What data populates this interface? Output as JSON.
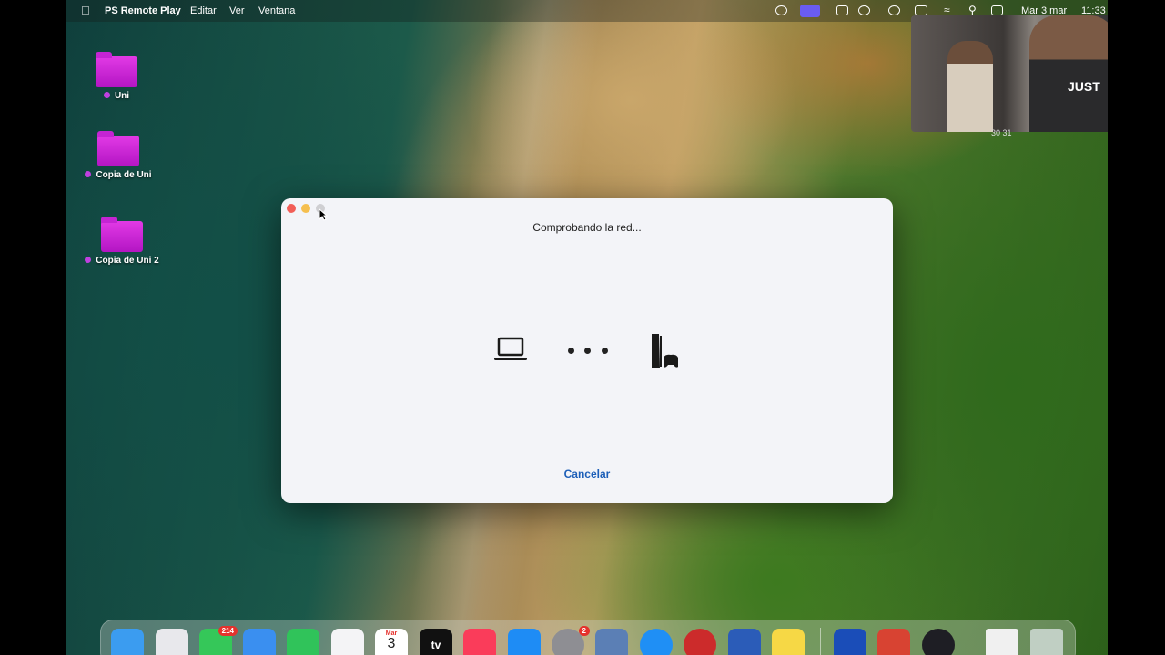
{
  "menubar": {
    "app_name": "PS Remote Play",
    "menus": [
      "Editar",
      "Ver",
      "Ventana"
    ],
    "date": "Mar 3 mar",
    "time": "11:33"
  },
  "desktop": {
    "items": [
      {
        "label": "Uni"
      },
      {
        "label": "Copia de Uni"
      },
      {
        "label": "Copia de Uni 2"
      }
    ]
  },
  "dialog": {
    "status": "Comprobando la red...",
    "cancel_label": "Cancelar",
    "icons": [
      "laptop-icon",
      "ps5-console-icon"
    ]
  },
  "camera_overlay": {
    "shirt_text": "JUST",
    "caption": "30  31"
  },
  "dock": {
    "calendar_month": "Mar",
    "calendar_day": "3",
    "tv_label": "tv",
    "badges": {
      "messages": "214",
      "settings": "2"
    },
    "apps": [
      "Finder",
      "Launchpad",
      "Messages",
      "Mail",
      "FaceTime",
      "Reminders",
      "Calendar",
      "TV",
      "Music",
      "App Store",
      "System Settings",
      "Preview",
      "Safari",
      "Vivaldi",
      "Word",
      "Notes",
      "PS Remote Play",
      "Rocket",
      "OBS",
      "Document",
      "Trash"
    ],
    "colors": {
      "finder": "#3b9cf0",
      "messages": "#35c759",
      "mail": "#3a8ff0",
      "facetime": "#30c35a",
      "music": "#fa3c5a",
      "appstore": "#1e8cf5",
      "settings": "#8e8e93",
      "safari": "#1f8ff5",
      "vivaldi": "#cc2b2b",
      "word": "#2b5cb8",
      "notes": "#f6d845",
      "psremote": "#1a4db8",
      "rocket": "#d84332",
      "obs": "#1e1e24"
    }
  },
  "accent_colors": {
    "window_bg": "#f3f4f8",
    "link": "#1d5fb8",
    "folder": "#c524d3"
  }
}
